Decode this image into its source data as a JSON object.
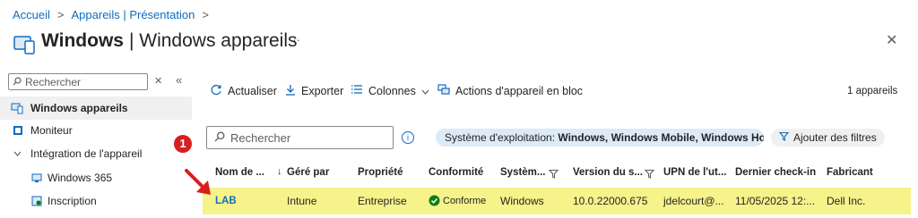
{
  "breadcrumb": {
    "home": "Accueil",
    "section": "Appareils | Présentation",
    "sep": ">"
  },
  "header": {
    "title_bold": "Windows",
    "title_rest": "| Windows appareils",
    "more": "···",
    "close": "✕"
  },
  "sidebar": {
    "search_placeholder": "Rechercher",
    "clear": "✕",
    "collapse": "«",
    "items": [
      {
        "label": "Windows appareils",
        "selected": true
      },
      {
        "label": "Moniteur"
      },
      {
        "label": "Intégration de l'appareil"
      },
      {
        "label": "Windows 365"
      },
      {
        "label": "Inscription"
      }
    ]
  },
  "toolbar": {
    "refresh": "Actualiser",
    "export": "Exporter",
    "columns": "Colonnes",
    "bulk": "Actions d'appareil en bloc",
    "count": "1 appareils"
  },
  "filter": {
    "search_placeholder": "Rechercher",
    "info": "i",
    "os_label": "Système d'exploitation: ",
    "os_value": "Windows, Windows Mobile, Windows Hol...",
    "add_filters": "Ajouter des filtres"
  },
  "table": {
    "columns": [
      "Nom de ...",
      "Géré par",
      "Propriété",
      "Conformité",
      "Systèm...",
      "Version du s...",
      "UPN de l'ut...",
      "Dernier check-in",
      "Fabricant"
    ],
    "rows": [
      {
        "name": "LAB",
        "managed": "Intune",
        "ownership": "Entreprise",
        "compliance": "Conforme",
        "os": "Windows",
        "version": "10.0.22000.675",
        "upn": "jdelcourt@...",
        "checkin": "11/05/2025 12:...",
        "maker": "Dell Inc."
      }
    ]
  },
  "annotation": {
    "marker": "1"
  },
  "colors": {
    "accent": "#0f6cbd",
    "highlight": "#f5f38a",
    "marker": "#d81e1e",
    "success": "#107c10"
  }
}
